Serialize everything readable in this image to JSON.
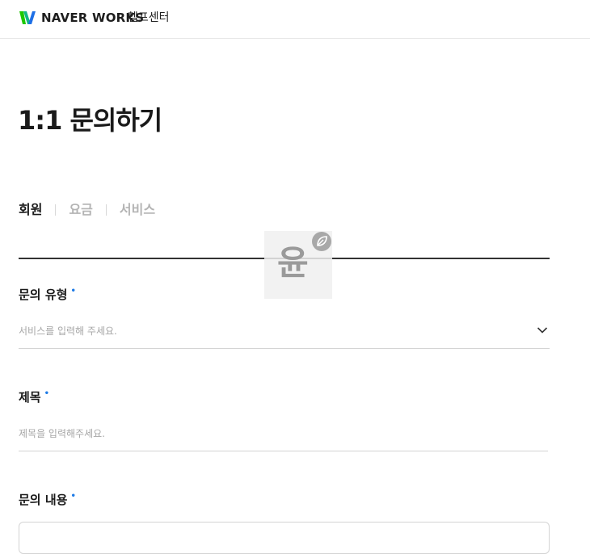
{
  "header": {
    "brand": "NAVER WORKS",
    "helpcenter": "헬프센터"
  },
  "page": {
    "title": "1:1 문의하기"
  },
  "tabs": [
    {
      "label": "회원",
      "active": true
    },
    {
      "label": "요금",
      "active": false
    },
    {
      "label": "서비스",
      "active": false
    }
  ],
  "watermark": {
    "text": "윤"
  },
  "form": {
    "inquiry_type": {
      "label": "문의 유형",
      "required_mark": "•",
      "placeholder": "서비스를 입력해 주세요."
    },
    "subject": {
      "label": "제목",
      "required_mark": "•",
      "placeholder": "제목을 입력해주세요."
    },
    "content": {
      "label": "문의 내용",
      "required_mark": "•"
    }
  },
  "colors": {
    "accent_blue": "#1e7be6",
    "logo_green": "#1ec800",
    "logo_blue": "#1e6fe6",
    "tab_inactive": "#b4b4b4"
  },
  "icons": {
    "logo": "naver-works-logo-icon",
    "dropdown": "chevron-down-icon",
    "watermark": "leaf-icon"
  }
}
